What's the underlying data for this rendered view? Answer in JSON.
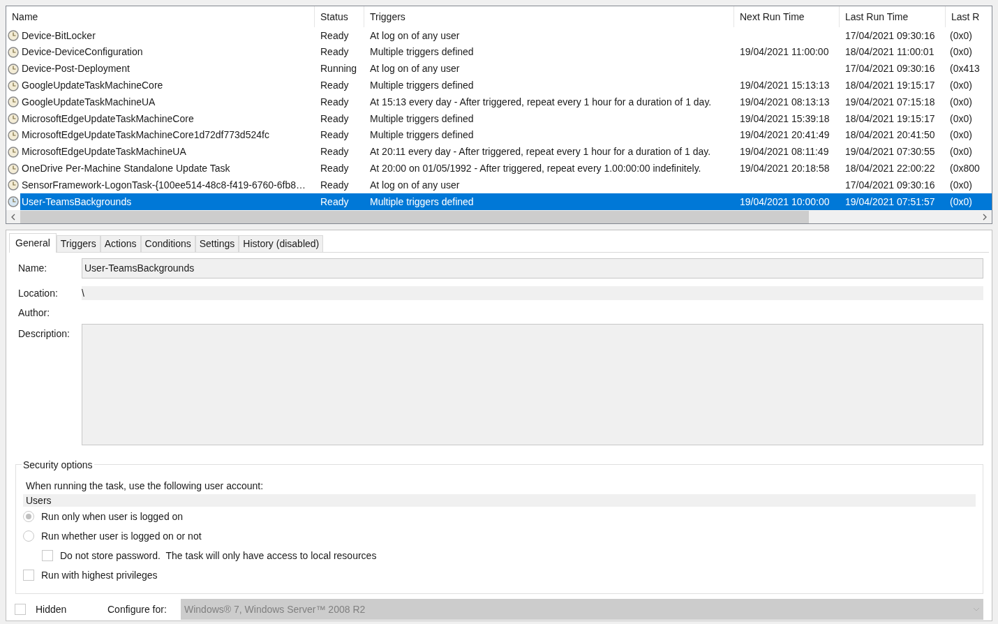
{
  "task_list": {
    "columns": [
      "Name",
      "Status",
      "Triggers",
      "Next Run Time",
      "Last Run Time",
      "Last R"
    ],
    "rows": [
      {
        "name": "Device-BitLocker",
        "status": "Ready",
        "triggers": "At log on of any user",
        "next_run_time": "",
        "last_run_time": "17/04/2021 09:30:16",
        "column_6": "(0x0)",
        "selected": false
      },
      {
        "name": "Device-DeviceConfiguration",
        "status": "Ready",
        "triggers": "Multiple triggers defined",
        "next_run_time": "19/04/2021 11:00:00",
        "last_run_time": "18/04/2021 11:00:01",
        "column_6": "(0x0)",
        "selected": false
      },
      {
        "name": "Device-Post-Deployment",
        "status": "Running",
        "triggers": "At log on of any user",
        "next_run_time": "",
        "last_run_time": "17/04/2021 09:30:16",
        "column_6": "(0x413",
        "selected": false
      },
      {
        "name": "GoogleUpdateTaskMachineCore",
        "status": "Ready",
        "triggers": "Multiple triggers defined",
        "next_run_time": "19/04/2021 15:13:13",
        "last_run_time": "18/04/2021 19:15:17",
        "column_6": "(0x0)",
        "selected": false
      },
      {
        "name": "GoogleUpdateTaskMachineUA",
        "status": "Ready",
        "triggers": "At 15:13 every day - After triggered, repeat every 1 hour for a duration of 1 day.",
        "next_run_time": "19/04/2021 08:13:13",
        "last_run_time": "19/04/2021 07:15:18",
        "column_6": "(0x0)",
        "selected": false
      },
      {
        "name": "MicrosoftEdgeUpdateTaskMachineCore",
        "status": "Ready",
        "triggers": "Multiple triggers defined",
        "next_run_time": "19/04/2021 15:39:18",
        "last_run_time": "18/04/2021 19:15:17",
        "column_6": "(0x0)",
        "selected": false
      },
      {
        "name": "MicrosoftEdgeUpdateTaskMachineCore1d72df773d524fc",
        "status": "Ready",
        "triggers": "Multiple triggers defined",
        "next_run_time": "19/04/2021 20:41:49",
        "last_run_time": "18/04/2021 20:41:50",
        "column_6": "(0x0)",
        "selected": false
      },
      {
        "name": "MicrosoftEdgeUpdateTaskMachineUA",
        "status": "Ready",
        "triggers": "At 20:11 every day - After triggered, repeat every 1 hour for a duration of 1 day.",
        "next_run_time": "19/04/2021 08:11:49",
        "last_run_time": "19/04/2021 07:30:55",
        "column_6": "(0x0)",
        "selected": false
      },
      {
        "name": "OneDrive Per-Machine Standalone Update Task",
        "status": "Ready",
        "triggers": "At 20:00 on 01/05/1992 - After triggered, repeat every 1.00:00:00 indefinitely.",
        "next_run_time": "19/04/2021 20:18:58",
        "last_run_time": "18/04/2021 22:00:22",
        "column_6": "(0x800",
        "selected": false
      },
      {
        "name": "SensorFramework-LogonTask-{100ee514-48c8-f419-6760-6fb8…",
        "status": "Ready",
        "triggers": "At log on of any user",
        "next_run_time": "",
        "last_run_time": "17/04/2021 09:30:16",
        "column_6": "(0x0)",
        "selected": false
      },
      {
        "name": "User-TeamsBackgrounds",
        "status": "Ready",
        "triggers": "Multiple triggers defined",
        "next_run_time": "19/04/2021 10:00:00",
        "last_run_time": "19/04/2021 07:51:57",
        "column_6": "(0x0)",
        "selected": true
      }
    ]
  },
  "tabs": [
    {
      "label": "General",
      "selected": true
    },
    {
      "label": "Triggers",
      "selected": false
    },
    {
      "label": "Actions",
      "selected": false
    },
    {
      "label": "Conditions",
      "selected": false
    },
    {
      "label": "Settings",
      "selected": false
    },
    {
      "label": "History (disabled)",
      "selected": false
    }
  ],
  "general": {
    "name_label": "Name:",
    "name_value": "User-TeamsBackgrounds",
    "location_label": "Location:",
    "location_value": "\\",
    "author_label": "Author:",
    "description_label": "Description:",
    "security": {
      "title": "Security options",
      "account_label": "When running the task, use the following user account:",
      "account_value": "Users",
      "options": [
        {
          "kind": "radio",
          "label": "Run only when user is logged on",
          "selected": true,
          "indent": false
        },
        {
          "kind": "radio",
          "label": "Run whether user is logged on or not",
          "selected": false,
          "indent": false
        },
        {
          "kind": "checkbox",
          "label": "Do not store password.  The task will only have access to local resources",
          "checked": false,
          "indent": true
        },
        {
          "kind": "checkbox",
          "label": "Run with highest privileges",
          "checked": false,
          "indent": false
        }
      ]
    },
    "hidden": {
      "label": "Hidden",
      "checked": false
    },
    "configure_label": "Configure for:",
    "configure_value": "Windows® 7, Windows Server™ 2008 R2"
  }
}
